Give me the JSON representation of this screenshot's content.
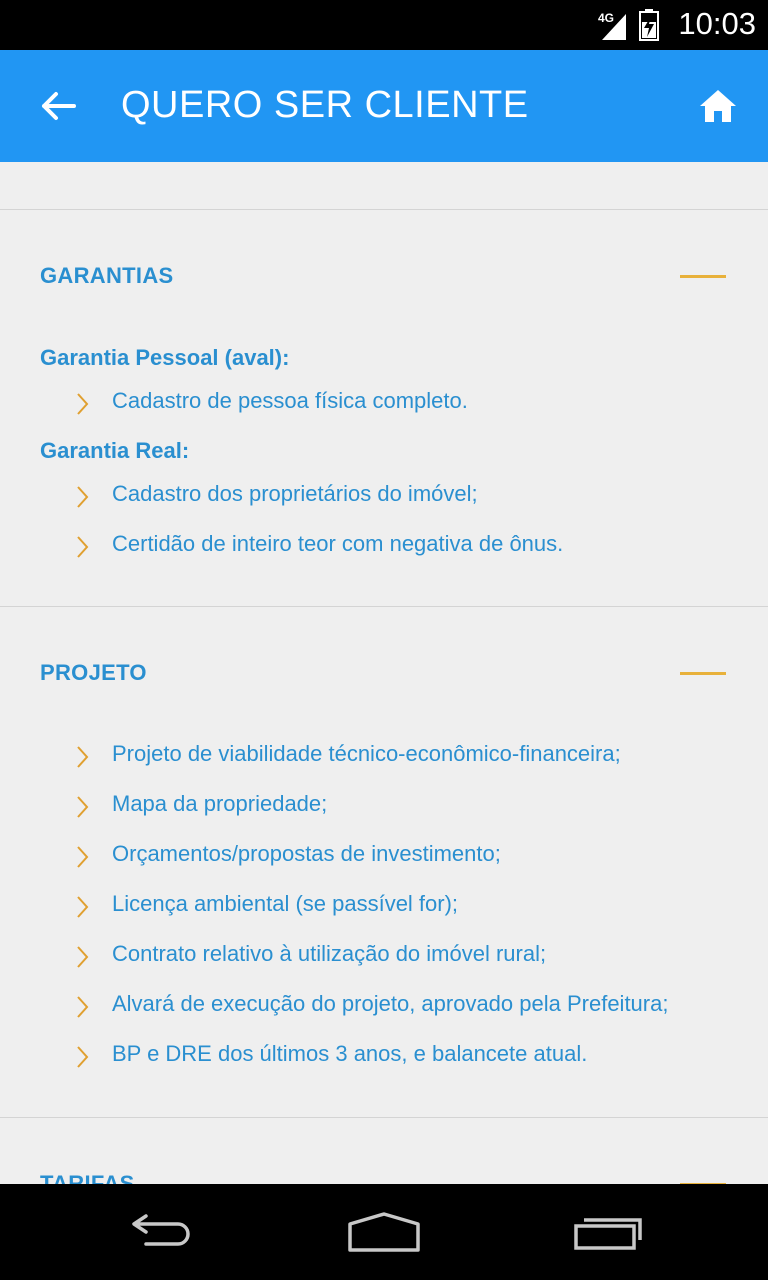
{
  "status_bar": {
    "time": "10:03",
    "network": "4G",
    "icons": [
      "signal-icon",
      "battery-charging-icon"
    ]
  },
  "app_bar": {
    "title": "QUERO SER CLIENTE",
    "back_icon": "arrow-left-icon",
    "home_icon": "home-icon",
    "color": "#2196F3"
  },
  "sections": {
    "garantias": {
      "title": "GARANTIAS",
      "groups": [
        {
          "subtitle": "Garantia Pessoal (aval):",
          "items": [
            "Cadastro de pessoa física completo."
          ]
        },
        {
          "subtitle": "Garantia Real:",
          "items": [
            "Cadastro dos proprietários do imóvel;",
            "Certidão de inteiro teor com negativa de ônus."
          ]
        }
      ]
    },
    "projeto": {
      "title": "PROJETO",
      "items": [
        "Projeto de viabilidade técnico-econômico-financeira;",
        "Mapa da propriedade;",
        "Orçamentos/propostas de investimento;",
        "Licença ambiental (se passível for);",
        "Contrato relativo à utilização do imóvel rural;",
        "Alvará de execução do projeto, aprovado pela Prefeitura;",
        "BP e DRE dos últimos 3 anos, e balancete atual."
      ]
    },
    "tarifas": {
      "title": "TARIFAS"
    }
  },
  "colors": {
    "accent": "#2a8fd0",
    "collapse": "#e8b13a",
    "chevron": "#e0a030",
    "background": "#efefef"
  },
  "nav_bar": {
    "icons": [
      "back-nav-icon",
      "home-nav-icon",
      "recents-nav-icon"
    ]
  }
}
